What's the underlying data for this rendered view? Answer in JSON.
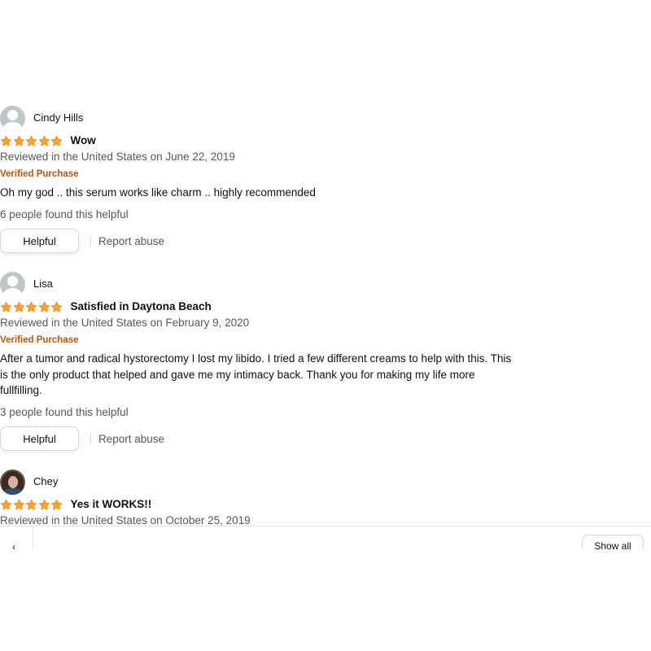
{
  "reviews": [
    {
      "name": "Cindy Hills",
      "avatar": "default-avatar",
      "rating": 5,
      "title": "Wow",
      "date": "Reviewed in the United States on June 22, 2019",
      "verified": "Verified Purchase",
      "body_lines": [
        "Oh my god .. this serum works like charm .. highly recommended"
      ],
      "helpful_count": "6 people found this helpful",
      "helpful_label": "Helpful",
      "report_label": "Report abuse"
    },
    {
      "name": "Lisa",
      "avatar": "default-avatar",
      "rating": 5,
      "title": "Satisfied in Daytona Beach",
      "date": "Reviewed in the United States on February 9, 2020",
      "verified": "Verified Purchase",
      "body_lines": [
        "After a tumor and radical hystorectomy I lost my libido. I tried a few different creams to help with this. This",
        "is the only product that helped and gave me my intimacy back. Thank you for making my life more",
        "fullfilling."
      ],
      "helpful_count": "3 people found this helpful",
      "helpful_label": "Helpful",
      "report_label": "Report abuse"
    },
    {
      "name": "Chey",
      "avatar": "photo-avatar",
      "rating": 5,
      "title": "Yes it WORKS!!",
      "date": "Reviewed in the United States on October 25, 2019"
    }
  ],
  "bottom_bar": {
    "nav_arrow": "‹",
    "show_all_label": "Show all"
  },
  "colors": {
    "star": "#ffa41c",
    "verified": "#c45500",
    "muted_text": "#565959"
  }
}
